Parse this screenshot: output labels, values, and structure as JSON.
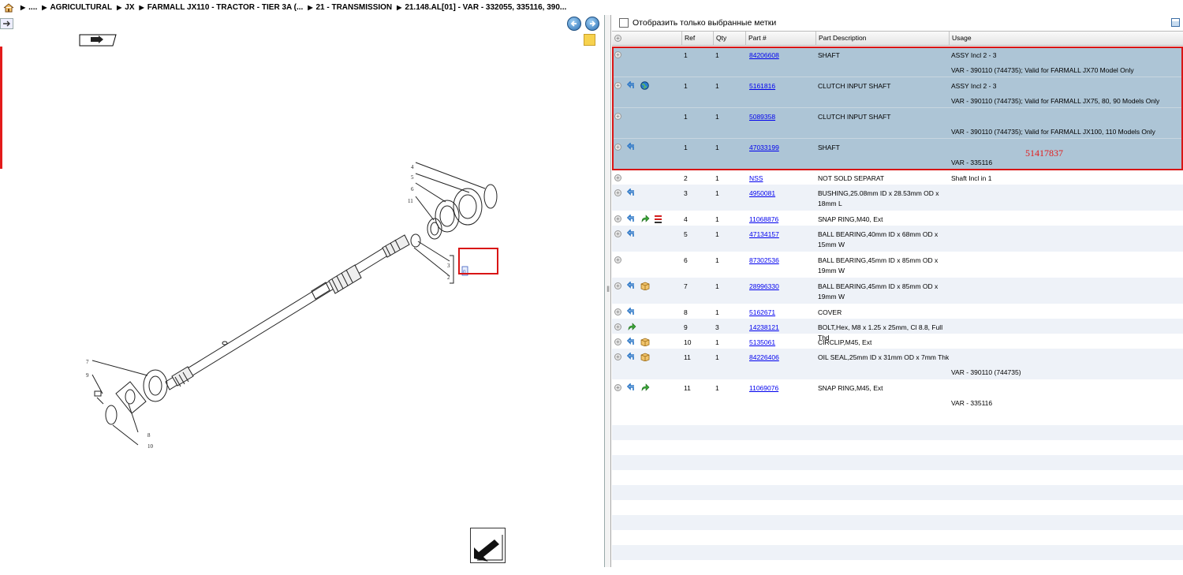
{
  "breadcrumb": {
    "items": [
      "....",
      "AGRICULTURAL",
      "JX",
      "FARMALL JX110 - TRACTOR - TIER 3A (...",
      "21 - TRANSMISSION",
      "21.148.AL[01] - VAR - 332055, 335116, 390..."
    ]
  },
  "nav": {
    "back_icon": "arrow-left-icon",
    "forward_icon": "arrow-right-icon"
  },
  "filter": {
    "label": "Отобразить только выбранные метки"
  },
  "table": {
    "headers": [
      "Ref",
      "Qty",
      "Part #",
      "Part Description",
      "Usage"
    ],
    "rows": [
      {
        "ref": "1",
        "qty": "1",
        "part": "84206608",
        "desc": "SHAFT",
        "usage": "ASSY Incl 2 - 3",
        "usage2": "VAR - 390110 (744735); Valid for FARMALL JX70 Model Only",
        "icons": []
      },
      {
        "ref": "1",
        "qty": "1",
        "part": "5161816",
        "desc": "CLUTCH INPUT SHAFT",
        "usage": "ASSY Incl 2 - 3",
        "usage2": "VAR - 390110 (744735); Valid for FARMALL JX75, 80, 90 Models Only",
        "icons": [
          "replace-arrow-icon",
          "globe-icon"
        ]
      },
      {
        "ref": "1",
        "qty": "1",
        "part": "5089358",
        "desc": "CLUTCH INPUT SHAFT",
        "usage": "",
        "usage2": "VAR - 390110 (744735); Valid for FARMALL JX100, 110 Models Only",
        "icons": []
      },
      {
        "ref": "1",
        "qty": "1",
        "part": "47033199",
        "desc": "SHAFT",
        "usage": "",
        "usage2": "VAR - 335116",
        "icons": [
          "replace-arrow-icon"
        ]
      },
      {
        "ref": "2",
        "qty": "1",
        "part": "NSS",
        "desc": "NOT SOLD SEPARAT",
        "usage": "Shaft Incl in 1",
        "usage2": "",
        "icons": []
      },
      {
        "ref": "3",
        "qty": "1",
        "part": "4950081",
        "desc": "BUSHING,25.08mm ID x 28.53mm OD x",
        "desc2": "18mm L",
        "usage": "",
        "usage2": "",
        "icons": [
          "replace-arrow-icon"
        ]
      },
      {
        "ref": "4",
        "qty": "1",
        "part": "11068876",
        "desc": "SNAP RING,M40, Ext",
        "usage": "",
        "usage2": "",
        "icons": [
          "replace-arrow-icon",
          "forward-green-icon",
          "list-red-icon"
        ]
      },
      {
        "ref": "5",
        "qty": "1",
        "part": "47134157",
        "desc": "BALL BEARING,40mm ID x 68mm OD x",
        "desc2": "15mm W",
        "usage": "",
        "usage2": "",
        "icons": [
          "replace-arrow-icon"
        ]
      },
      {
        "ref": "6",
        "qty": "1",
        "part": "87302536",
        "desc": "BALL BEARING,45mm ID x 85mm OD x",
        "desc2": "19mm W",
        "usage": "",
        "usage2": "",
        "icons": []
      },
      {
        "ref": "7",
        "qty": "1",
        "part": "28996330",
        "desc": "BALL BEARING,45mm ID x 85mm OD x",
        "desc2": "19mm W",
        "usage": "",
        "usage2": "",
        "icons": [
          "replace-arrow-icon",
          "box-icon"
        ]
      },
      {
        "ref": "8",
        "qty": "1",
        "part": "5162671",
        "desc": "COVER",
        "usage": "",
        "usage2": "",
        "icons": [
          "replace-arrow-icon"
        ]
      },
      {
        "ref": "9",
        "qty": "3",
        "part": "14238121",
        "desc": "BOLT,Hex, M8 x 1.25 x 25mm, Cl 8.8, Full",
        "desc2": "Thd",
        "usage": "",
        "usage2": "",
        "icons": [
          "forward-green-icon"
        ]
      },
      {
        "ref": "10",
        "qty": "1",
        "part": "5135061",
        "desc": "CIRCLIP,M45, Ext",
        "usage": "",
        "usage2": "",
        "icons": [
          "replace-arrow-icon",
          "box-icon"
        ]
      },
      {
        "ref": "11",
        "qty": "1",
        "part": "84226406",
        "desc": "OIL SEAL,25mm ID x 31mm OD x 7mm Thk",
        "usage": "",
        "usage2": "VAR - 390110 (744735)",
        "icons": [
          "replace-arrow-icon",
          "box-icon"
        ]
      },
      {
        "ref": "11",
        "qty": "1",
        "part": "11069076",
        "desc": "SNAP RING,M45, Ext",
        "usage": "",
        "usage2": "VAR - 335116",
        "icons": [
          "replace-arrow-icon",
          "forward-green-icon"
        ]
      }
    ]
  },
  "annotation": {
    "red_number": "51417837"
  },
  "diagram": {
    "callouts": [
      "4",
      "5",
      "6",
      "11",
      "3",
      "2",
      "7",
      "9",
      "8",
      "10"
    ],
    "selected_ref": "0"
  },
  "colors": {
    "selection_row": "#adc5d6",
    "highlight_red": "#d91515",
    "link": "#0000ee"
  }
}
